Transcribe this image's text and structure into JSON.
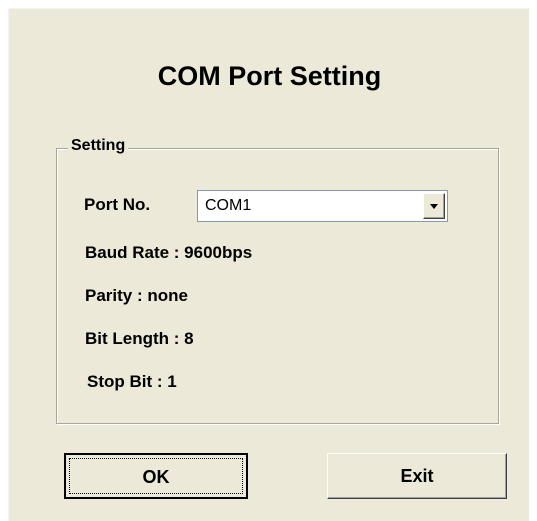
{
  "dialog": {
    "title": "COM Port Setting"
  },
  "setting_group": {
    "legend": "Setting",
    "port_label": "Port No.",
    "port_value": "COM1",
    "baud_rate": "Baud Rate : 9600bps",
    "parity": "Parity : none",
    "bit_length": "Bit Length : 8",
    "stop_bit": "Stop Bit : 1"
  },
  "buttons": {
    "ok_label": "OK",
    "exit_label": "Exit"
  },
  "icons": {
    "combo_dropdown": "chevron-down-icon"
  }
}
